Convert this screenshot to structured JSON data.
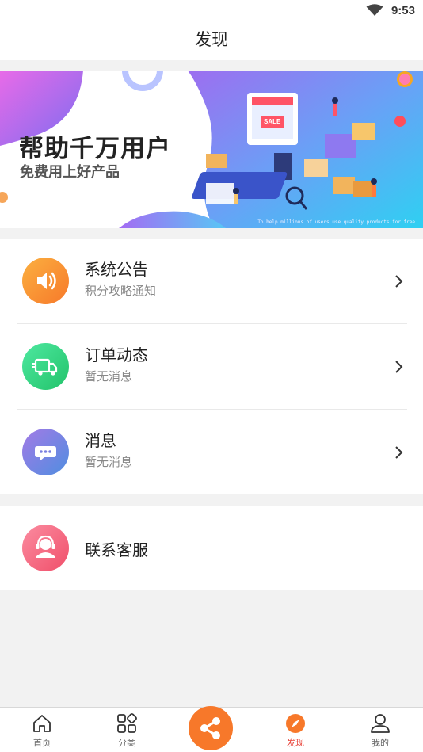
{
  "status_bar": {
    "time": "9:53",
    "wifi_icon": "wifi-icon"
  },
  "header": {
    "title": "发现"
  },
  "banner": {
    "headline": "帮助千万用户",
    "subline": "免费用上好产品",
    "caption": "To help millions of users use quality products for free",
    "sign_text": "SALE"
  },
  "list": [
    {
      "label": "系统公告",
      "sub": "积分攻略通知",
      "icon": "speaker-icon",
      "color": "#f98a2c"
    },
    {
      "label": "订单动态",
      "sub": "暂无消息",
      "icon": "delivery-truck-icon",
      "color": "#35d07f"
    },
    {
      "label": "消息",
      "sub": "暂无消息",
      "icon": "chat-bubble-icon",
      "color": "#6d84e0"
    }
  ],
  "service": {
    "label": "联系客服",
    "icon": "customer-service-icon",
    "color": "#f6607a"
  },
  "bottom_nav": [
    {
      "label": "首页",
      "icon": "home-icon"
    },
    {
      "label": "分类",
      "icon": "category-icon"
    },
    {
      "label": "",
      "icon": "share-icon"
    },
    {
      "label": "发现",
      "icon": "compass-icon",
      "active": true
    },
    {
      "label": "我的",
      "icon": "user-icon"
    }
  ],
  "colors": {
    "accent": "#f7782a",
    "active": "#e8453c"
  }
}
